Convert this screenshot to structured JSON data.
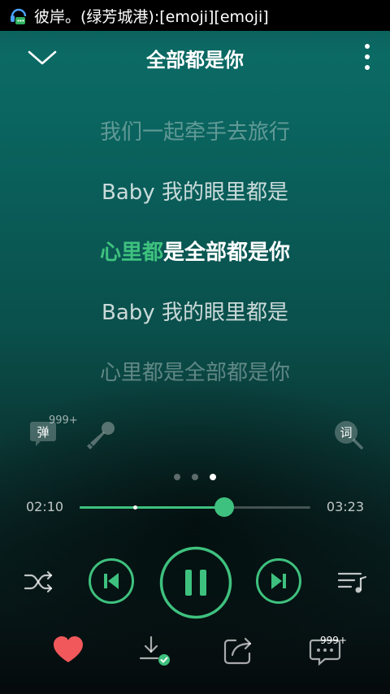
{
  "status_bar": {
    "notification": "彼岸。(绿芳城港):[emoji][emoji]"
  },
  "header": {
    "title": "全部都是你"
  },
  "lyrics": {
    "line1": "我们一起牵手去旅行",
    "line2": "Baby 我的眼里都是",
    "line3_sung": "心里都",
    "line3_rest": "是全部都是你",
    "line4": "Baby 我的眼里都是",
    "line5": "心里都是全部都是你"
  },
  "tools": {
    "danmu_label": "弹",
    "danmu_count": "999+",
    "lyrics_label": "词"
  },
  "pager": {
    "count": 3,
    "active_index": 2
  },
  "playback": {
    "current_time": "02:10",
    "total_time": "03:23",
    "played_fraction": 0.626,
    "buffered_fraction": 0.24
  },
  "actions": {
    "comment_count": "999+"
  },
  "colors": {
    "accent": "#3ec17e",
    "like": "#f0585b"
  }
}
